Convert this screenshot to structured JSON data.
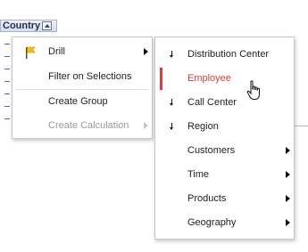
{
  "column_header": {
    "label": "Country"
  },
  "main_menu": {
    "items": [
      {
        "label": "Drill",
        "has_submenu": true,
        "disabled": false,
        "icon": "drill-flag-icon"
      },
      {
        "label": "Filter on Selections",
        "has_submenu": false,
        "disabled": false
      },
      {
        "label": "Create Group",
        "has_submenu": false,
        "disabled": false
      },
      {
        "label": "Create Calculation",
        "has_submenu": true,
        "disabled": true
      }
    ]
  },
  "submenu": {
    "items": [
      {
        "label": "Distribution Center",
        "icon": "down-arrow-icon"
      },
      {
        "label": "Employee",
        "icon": "down-arrow-icon",
        "highlighted": true
      },
      {
        "label": "Call Center",
        "icon": "down-arrow-icon"
      },
      {
        "label": "Region",
        "icon": "down-arrow-icon"
      },
      {
        "label": "Customers",
        "has_submenu": true
      },
      {
        "label": "Time",
        "has_submenu": true
      },
      {
        "label": "Products",
        "has_submenu": true
      },
      {
        "label": "Geography",
        "has_submenu": true
      }
    ]
  },
  "colors": {
    "highlight": "#d83b3b",
    "disabled": "#9a9a9a"
  }
}
